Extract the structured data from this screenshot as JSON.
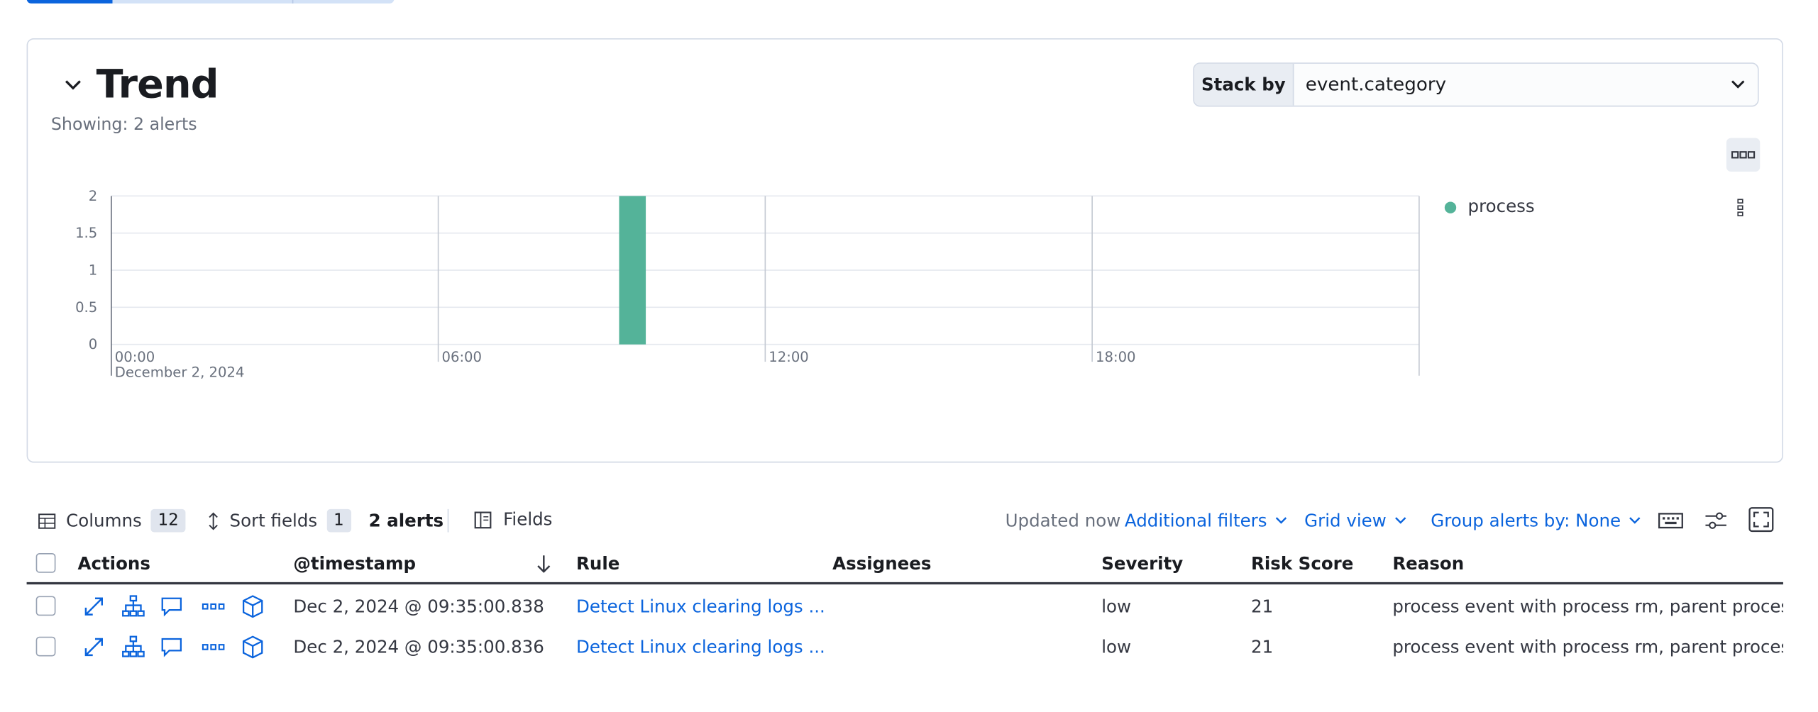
{
  "trend": {
    "title": "Trend",
    "showing": "Showing: 2 alerts",
    "stack_by_label": "Stack by",
    "stack_by_value": "event.category"
  },
  "legend": {
    "items": [
      {
        "label": "process",
        "color": "#54b399"
      }
    ]
  },
  "chart_data": {
    "type": "bar",
    "y_ticks": [
      "2",
      "1.5",
      "1",
      "0.5",
      "0"
    ],
    "ylim": [
      0,
      2
    ],
    "x_ticks": [
      "00:00",
      "06:00",
      "12:00",
      "18:00"
    ],
    "x_sublabel": "December 2, 2024",
    "series": [
      {
        "name": "process",
        "color": "#54b399",
        "points": [
          {
            "x_hours": 9.5,
            "y": 2
          }
        ]
      }
    ],
    "x_range_hours": [
      0,
      24
    ],
    "grid": true
  },
  "toolbar": {
    "columns_label": "Columns",
    "columns_count": "12",
    "sort_label": "Sort fields",
    "sort_count": "1",
    "alerts_count": "2 alerts",
    "fields_label": "Fields",
    "updated": "Updated now",
    "additional_filters": "Additional filters",
    "grid_view": "Grid view",
    "group_by": "Group alerts by: None"
  },
  "table": {
    "headers": {
      "actions": "Actions",
      "timestamp": "@timestamp",
      "rule": "Rule",
      "assignees": "Assignees",
      "severity": "Severity",
      "risk": "Risk Score",
      "reason": "Reason"
    },
    "rows": [
      {
        "timestamp": "Dec 2, 2024 @ 09:35:00.838",
        "rule": "Detect Linux clearing logs ...",
        "assignees": "",
        "severity": "low",
        "risk": "21",
        "reason": "process event with process rm, parent process s"
      },
      {
        "timestamp": "Dec 2, 2024 @ 09:35:00.836",
        "rule": "Detect Linux clearing logs ...",
        "assignees": "",
        "severity": "low",
        "risk": "21",
        "reason": "process event with process rm, parent process s"
      }
    ]
  },
  "icons": [
    "chevron-down-icon",
    "boxes-horizontal-icon",
    "boxes-vertical-icon",
    "table-icon",
    "sort-icon",
    "fields-icon",
    "keyboard-icon",
    "settings-icon",
    "fullscreen-icon",
    "arrow-down-icon",
    "expand-icon",
    "analyze-icon",
    "comment-icon",
    "more-icon",
    "session-view-icon"
  ],
  "colors": {
    "accent": "#0b64dd",
    "bar": "#54b399"
  }
}
